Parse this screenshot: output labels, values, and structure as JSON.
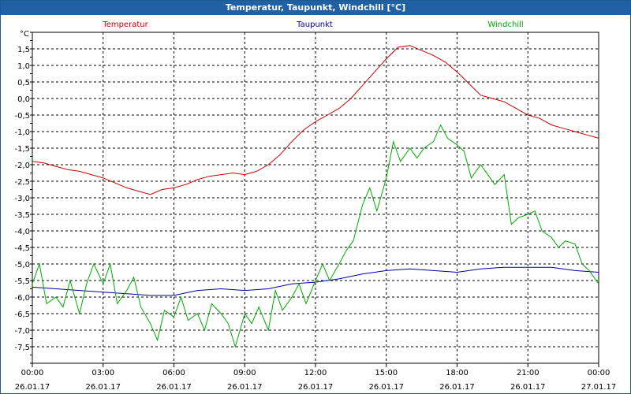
{
  "window": {
    "title": "Temperatur, Taupunkt, Windchill [°C]"
  },
  "chart_data": {
    "type": "line",
    "title": "Temperatur, Taupunkt, Windchill [°C]",
    "ylabel": "°C",
    "ylim": [
      -8,
      2
    ],
    "yticks": [
      1.5,
      1.0,
      0.5,
      0.0,
      -0.5,
      -1.0,
      -1.5,
      -2.0,
      -2.5,
      -3.0,
      -3.5,
      -4.0,
      -4.5,
      -5.0,
      -5.5,
      -6.0,
      -6.5,
      -7.0,
      -7.5
    ],
    "ytick_labels": [
      "1,5",
      "1,0",
      "0,5",
      "0,0",
      "-0,5",
      "-1,0",
      "-1,5",
      "-2,0",
      "-2,5",
      "-3,0",
      "-3,5",
      "-4,0",
      "-4,5",
      "-5,0",
      "-5,5",
      "-6,0",
      "-6,5",
      "-7,0",
      "-7,5"
    ],
    "xlim": [
      0,
      24
    ],
    "xticks": [
      {
        "x": 0,
        "time": "00:00",
        "date": "26.01.17"
      },
      {
        "x": 3,
        "time": "03:00",
        "date": "26.01.17"
      },
      {
        "x": 6,
        "time": "06:00",
        "date": "26.01.17"
      },
      {
        "x": 9,
        "time": "09:00",
        "date": "26.01.17"
      },
      {
        "x": 12,
        "time": "12:00",
        "date": "26.01.17"
      },
      {
        "x": 15,
        "time": "15:00",
        "date": "26.01.17"
      },
      {
        "x": 18,
        "time": "18:00",
        "date": "26.01.17"
      },
      {
        "x": 21,
        "time": "21:00",
        "date": "26.01.17"
      },
      {
        "x": 24,
        "time": "00:00",
        "date": "27.01.17"
      }
    ],
    "grid": true,
    "legend": "top",
    "series": [
      {
        "name": "Temperatur",
        "color": "#cc0000",
        "points": [
          [
            0,
            -1.9
          ],
          [
            0.5,
            -1.95
          ],
          [
            1,
            -2.05
          ],
          [
            1.5,
            -2.15
          ],
          [
            2,
            -2.2
          ],
          [
            2.5,
            -2.3
          ],
          [
            3,
            -2.4
          ],
          [
            3.5,
            -2.55
          ],
          [
            4,
            -2.7
          ],
          [
            4.5,
            -2.8
          ],
          [
            5,
            -2.9
          ],
          [
            5.5,
            -2.75
          ],
          [
            6,
            -2.7
          ],
          [
            6.5,
            -2.6
          ],
          [
            7,
            -2.45
          ],
          [
            7.5,
            -2.35
          ],
          [
            8,
            -2.3
          ],
          [
            8.5,
            -2.25
          ],
          [
            9,
            -2.3
          ],
          [
            9.5,
            -2.2
          ],
          [
            10,
            -2.0
          ],
          [
            10.5,
            -1.7
          ],
          [
            11,
            -1.3
          ],
          [
            11.5,
            -0.95
          ],
          [
            12,
            -0.7
          ],
          [
            12.5,
            -0.5
          ],
          [
            13,
            -0.3
          ],
          [
            13.5,
            0.0
          ],
          [
            14,
            0.4
          ],
          [
            14.5,
            0.8
          ],
          [
            15,
            1.2
          ],
          [
            15.5,
            1.55
          ],
          [
            16,
            1.6
          ],
          [
            16.5,
            1.45
          ],
          [
            17,
            1.3
          ],
          [
            17.5,
            1.1
          ],
          [
            18,
            0.8
          ],
          [
            18.5,
            0.45
          ],
          [
            19,
            0.1
          ],
          [
            19.5,
            0.0
          ],
          [
            20,
            -0.1
          ],
          [
            20.5,
            -0.3
          ],
          [
            21,
            -0.5
          ],
          [
            21.5,
            -0.6
          ],
          [
            22,
            -0.8
          ],
          [
            22.5,
            -0.9
          ],
          [
            23,
            -1.0
          ],
          [
            23.5,
            -1.1
          ],
          [
            24,
            -1.2
          ]
        ]
      },
      {
        "name": "Taupunkt",
        "color": "#0000aa",
        "points": [
          [
            0,
            -5.7
          ],
          [
            1,
            -5.75
          ],
          [
            2,
            -5.8
          ],
          [
            3,
            -5.85
          ],
          [
            4,
            -5.9
          ],
          [
            5,
            -5.95
          ],
          [
            6,
            -5.95
          ],
          [
            7,
            -5.8
          ],
          [
            8,
            -5.75
          ],
          [
            9,
            -5.8
          ],
          [
            10,
            -5.75
          ],
          [
            11,
            -5.6
          ],
          [
            12,
            -5.55
          ],
          [
            13,
            -5.45
          ],
          [
            14,
            -5.3
          ],
          [
            15,
            -5.2
          ],
          [
            16,
            -5.15
          ],
          [
            17,
            -5.2
          ],
          [
            18,
            -5.25
          ],
          [
            19,
            -5.15
          ],
          [
            20,
            -5.1
          ],
          [
            21,
            -5.1
          ],
          [
            22,
            -5.1
          ],
          [
            23,
            -5.2
          ],
          [
            24,
            -5.25
          ]
        ]
      },
      {
        "name": "Windchill",
        "color": "#00aa00",
        "points": [
          [
            0,
            -5.6
          ],
          [
            0.3,
            -5.0
          ],
          [
            0.6,
            -6.2
          ],
          [
            1,
            -6.0
          ],
          [
            1.3,
            -6.3
          ],
          [
            1.6,
            -5.5
          ],
          [
            2,
            -6.5
          ],
          [
            2.3,
            -5.6
          ],
          [
            2.6,
            -5.0
          ],
          [
            3,
            -5.6
          ],
          [
            3.3,
            -5.0
          ],
          [
            3.6,
            -6.2
          ],
          [
            4,
            -5.8
          ],
          [
            4.3,
            -5.4
          ],
          [
            4.6,
            -6.3
          ],
          [
            5,
            -6.8
          ],
          [
            5.3,
            -7.3
          ],
          [
            5.6,
            -6.4
          ],
          [
            6,
            -6.6
          ],
          [
            6.3,
            -6.0
          ],
          [
            6.6,
            -6.7
          ],
          [
            7,
            -6.5
          ],
          [
            7.3,
            -7.0
          ],
          [
            7.6,
            -6.2
          ],
          [
            8,
            -6.5
          ],
          [
            8.3,
            -6.8
          ],
          [
            8.6,
            -7.5
          ],
          [
            9,
            -6.5
          ],
          [
            9.3,
            -6.8
          ],
          [
            9.6,
            -6.3
          ],
          [
            10,
            -7.0
          ],
          [
            10.3,
            -5.8
          ],
          [
            10.6,
            -6.4
          ],
          [
            11,
            -6.0
          ],
          [
            11.3,
            -5.6
          ],
          [
            11.6,
            -6.2
          ],
          [
            12,
            -5.5
          ],
          [
            12.3,
            -5.0
          ],
          [
            12.6,
            -5.5
          ],
          [
            13,
            -5.0
          ],
          [
            13.3,
            -4.6
          ],
          [
            13.6,
            -4.3
          ],
          [
            14,
            -3.2
          ],
          [
            14.3,
            -2.7
          ],
          [
            14.6,
            -3.4
          ],
          [
            15,
            -2.4
          ],
          [
            15.3,
            -1.3
          ],
          [
            15.6,
            -1.9
          ],
          [
            16,
            -1.5
          ],
          [
            16.3,
            -1.8
          ],
          [
            16.6,
            -1.5
          ],
          [
            17,
            -1.3
          ],
          [
            17.3,
            -0.8
          ],
          [
            17.6,
            -1.2
          ],
          [
            18,
            -1.4
          ],
          [
            18.3,
            -1.6
          ],
          [
            18.6,
            -2.4
          ],
          [
            19,
            -2.0
          ],
          [
            19.3,
            -2.3
          ],
          [
            19.6,
            -2.6
          ],
          [
            20,
            -2.3
          ],
          [
            20.3,
            -3.8
          ],
          [
            20.6,
            -3.6
          ],
          [
            21,
            -3.5
          ],
          [
            21.3,
            -3.4
          ],
          [
            21.6,
            -4.0
          ],
          [
            22,
            -4.2
          ],
          [
            22.3,
            -4.5
          ],
          [
            22.6,
            -4.3
          ],
          [
            23,
            -4.4
          ],
          [
            23.3,
            -5.0
          ],
          [
            23.6,
            -5.2
          ],
          [
            24,
            -5.6
          ]
        ]
      }
    ]
  }
}
